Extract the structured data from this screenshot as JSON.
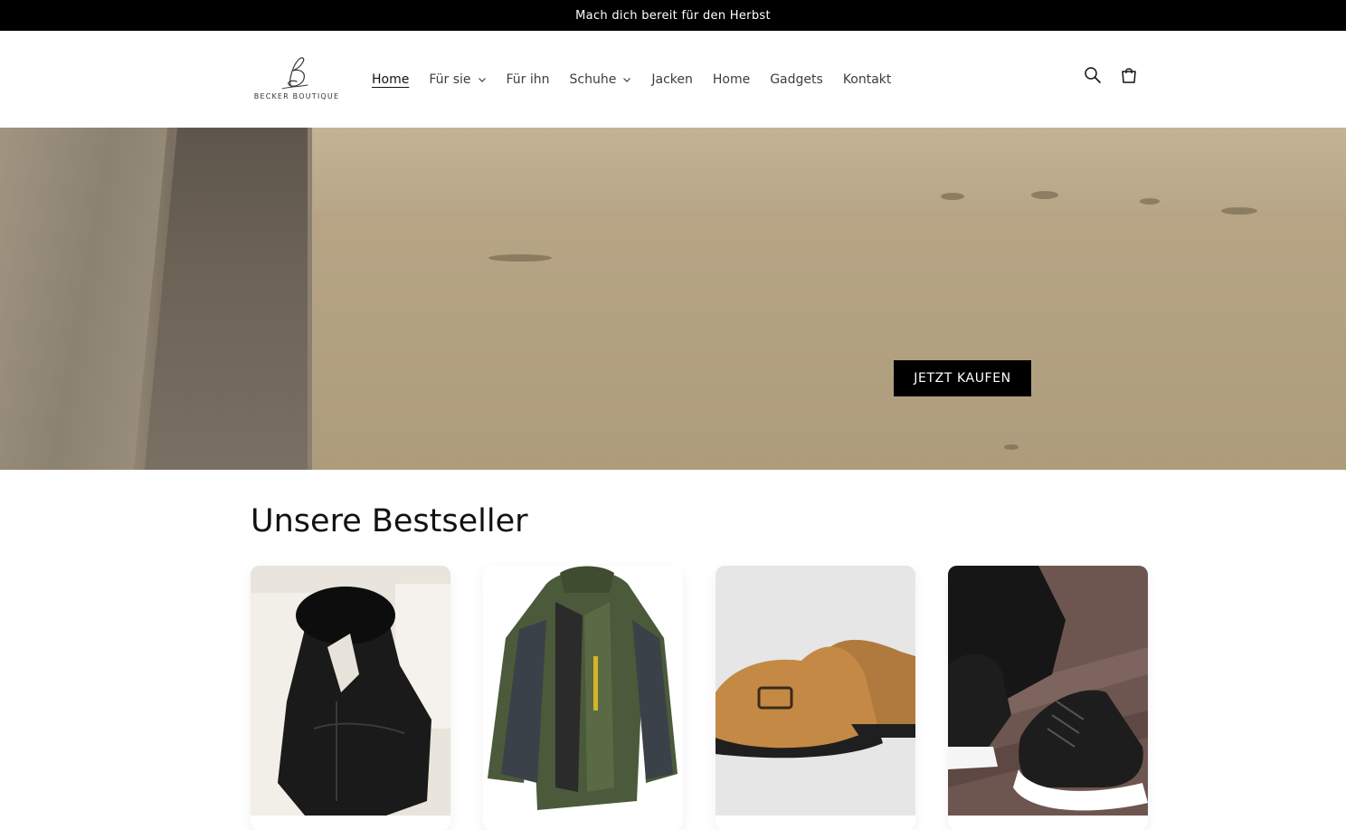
{
  "announcement": {
    "text": "Mach dich bereit für den Herbst"
  },
  "header": {
    "logo_text": "BECKER BOUTIQUE",
    "nav": [
      {
        "label": "Home",
        "active": true,
        "has_dropdown": false
      },
      {
        "label": "Für sie",
        "active": false,
        "has_dropdown": true
      },
      {
        "label": "Für ihn",
        "active": false,
        "has_dropdown": false
      },
      {
        "label": "Schuhe",
        "active": false,
        "has_dropdown": true
      },
      {
        "label": "Jacken",
        "active": false,
        "has_dropdown": false
      },
      {
        "label": "Home",
        "active": false,
        "has_dropdown": false
      },
      {
        "label": "Gadgets",
        "active": false,
        "has_dropdown": false
      },
      {
        "label": "Kontakt",
        "active": false,
        "has_dropdown": false
      }
    ],
    "icons": [
      "search-icon",
      "cart-icon"
    ]
  },
  "hero": {
    "cta_label": "JETZT KAUFEN"
  },
  "bestsellers": {
    "title": "Unsere Bestseller",
    "products": [
      {
        "image": "black-parka-jacket"
      },
      {
        "image": "green-winter-jacket"
      },
      {
        "image": "brown-suede-clogs"
      },
      {
        "image": "black-running-sneakers"
      }
    ]
  },
  "colors": {
    "announcement_bg": "#000000",
    "cta_bg": "#000000",
    "text": "#121212"
  }
}
